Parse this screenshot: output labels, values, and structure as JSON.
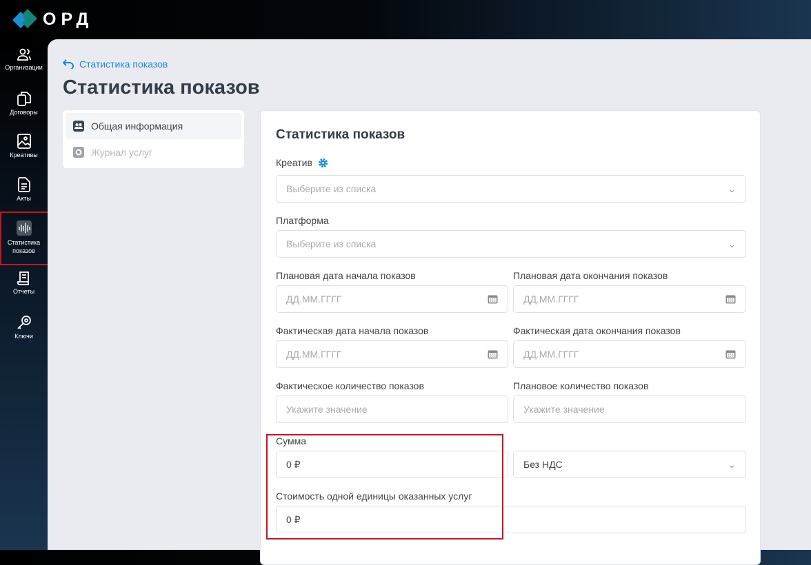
{
  "app": {
    "logo": "ОРД"
  },
  "sidebar": {
    "items": [
      {
        "label": "Организации",
        "icon": "users-icon"
      },
      {
        "label": "Договоры",
        "icon": "documents-icon"
      },
      {
        "label": "Креативы",
        "icon": "image-icon"
      },
      {
        "label": "Акты",
        "icon": "file-icon"
      },
      {
        "label": "Статистика показов",
        "icon": "stats-icon"
      },
      {
        "label": "Отчеты",
        "icon": "report-icon"
      },
      {
        "label": "Ключи",
        "icon": "key-icon"
      }
    ]
  },
  "breadcrumb": {
    "back": "Статистика показов"
  },
  "page": {
    "title": "Статистика показов"
  },
  "menu": {
    "items": [
      {
        "label": "Общая информация"
      },
      {
        "label": "Журнал услуг"
      }
    ]
  },
  "form": {
    "title": "Статистика показов",
    "creative": {
      "label": "Креатив",
      "placeholder": "Выберите из списка"
    },
    "platform": {
      "label": "Платформа",
      "placeholder": "Выберите из списка"
    },
    "plan_start": {
      "label": "Плановая дата начала показов",
      "placeholder": "ДД.ММ.ГГГГ"
    },
    "plan_end": {
      "label": "Плановая дата окончания показов",
      "placeholder": "ДД.ММ.ГГГГ"
    },
    "fact_start": {
      "label": "Фактическая дата начала показов",
      "placeholder": "ДД.ММ.ГГГГ"
    },
    "fact_end": {
      "label": "Фактическая дата окончания показов",
      "placeholder": "ДД.ММ.ГГГГ"
    },
    "fact_count": {
      "label": "Фактическое количество показов",
      "placeholder": "Укажите значение"
    },
    "plan_count": {
      "label": "Плановое количество показов",
      "placeholder": "Укажите значение"
    },
    "sum": {
      "label": "Сумма",
      "value": "0 ₽"
    },
    "vat": {
      "value": "Без НДС"
    },
    "unit_cost": {
      "label": "Стоимость одной единицы оказанных услуг",
      "value": "0 ₽"
    }
  }
}
